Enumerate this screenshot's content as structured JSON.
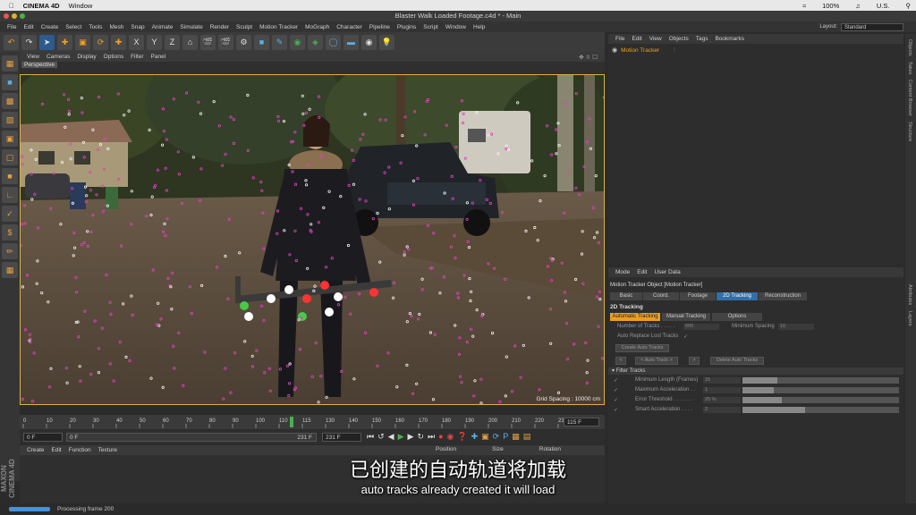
{
  "macbar": {
    "app": "CINEMA 4D",
    "menu": "Window",
    "battery": "100%",
    "locale": "U.S."
  },
  "window": {
    "title": "Blaster Walk Loaded Footage.c4d * - Main"
  },
  "c4d_menu": [
    "File",
    "Edit",
    "Create",
    "Select",
    "Tools",
    "Mesh",
    "Snap",
    "Animate",
    "Simulate",
    "Render",
    "Sculpt",
    "Motion Tracker",
    "MoGraph",
    "Character",
    "Pipeline",
    "Plugins",
    "Script",
    "Window",
    "Help"
  ],
  "layout": {
    "label": "Layout:",
    "value": "Standard"
  },
  "viewport": {
    "menu": [
      "View",
      "Cameras",
      "Display",
      "Options",
      "Filter",
      "Panel"
    ],
    "camera_label": "Perspective",
    "grid_spacing": "Grid Spacing : 10000 cm"
  },
  "timeline": {
    "ticks": [
      "0",
      "10",
      "20",
      "30",
      "40",
      "50",
      "60",
      "70",
      "80",
      "90",
      "100",
      "110",
      "115",
      "130",
      "140",
      "150",
      "160",
      "170",
      "180",
      "190",
      "200",
      "210",
      "220",
      "230"
    ],
    "current_frame": "115 F",
    "start_field": "0 F",
    "range_start": "0 F",
    "range_end": "231 F",
    "end_field": "231 F"
  },
  "bottom": {
    "menu": [
      "Create",
      "Edit",
      "Function",
      "Texture"
    ],
    "columns": [
      "Position",
      "Size",
      "Rotation"
    ],
    "logo": "MAXON CINEMA 4D"
  },
  "status": {
    "text": "Processing frame 200"
  },
  "objects": {
    "menu": [
      "File",
      "Edit",
      "View",
      "Objects",
      "Tags",
      "Bookmarks"
    ],
    "items": [
      {
        "label": "Motion Tracker"
      }
    ]
  },
  "attributes": {
    "menu": [
      "Mode",
      "Edit",
      "User Data"
    ],
    "object_title": "Motion Tracker Object [Motion Tracker]",
    "tabs": [
      "Basic",
      "Coord.",
      "Footage",
      "2D Tracking",
      "Reconstruction"
    ],
    "active_tab": "2D Tracking",
    "section": "2D Tracking",
    "subtabs": [
      "Automatic Tracking",
      "Manual Tracking",
      "Options"
    ],
    "num_tracks_label": "Number of Tracks . . . . .",
    "num_tracks_value": "600",
    "min_spacing_label": "Minimum Spacing",
    "min_spacing_value": "10",
    "auto_replace_label": "Auto Replace Lost Tracks",
    "create_button": "Create Auto Tracks",
    "nav_prev": "<",
    "auto_track_button": "< Auto Track >",
    "nav_next": ">",
    "delete_button": "Delete Auto Tracks",
    "filter_section": "Filter Tracks",
    "filters": [
      {
        "label": "Minimum Length (Frames)",
        "value": "15",
        "fill": 0.22
      },
      {
        "label": "Maximum Acceleration . .",
        "value": "1",
        "fill": 0.2
      },
      {
        "label": "Error Threshold . . . . . . .",
        "value": "25 %",
        "fill": 0.25
      },
      {
        "label": "Smart Acceleration . . . .",
        "value": "2",
        "fill": 0.4
      }
    ]
  },
  "right_strip": [
    "Objects",
    "Takes",
    "Content Browser",
    "Structure",
    "Attributes",
    "Layers"
  ],
  "subtitles": {
    "chinese": "已创建的自动轨道将加载",
    "english": "auto tracks already created it will load"
  }
}
